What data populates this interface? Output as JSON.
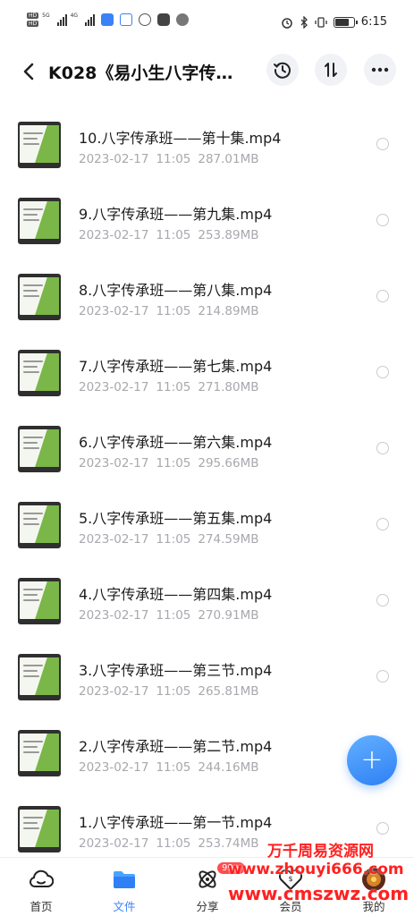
{
  "status_bar": {
    "time": "6:15",
    "network_tags": [
      "HD",
      "HD"
    ],
    "signal_tags": [
      "5G",
      "4G"
    ]
  },
  "header": {
    "title": "K028《易小生八字传…",
    "history_icon": "history-icon",
    "sort_icon": "sort-icon",
    "more_icon": "more-icon"
  },
  "files": [
    {
      "name": "10.八字传承班——第十集.mp4",
      "date": "2023-02-17",
      "time": "11:05",
      "size": "287.01MB"
    },
    {
      "name": "9.八字传承班——第九集.mp4",
      "date": "2023-02-17",
      "time": "11:05",
      "size": "253.89MB"
    },
    {
      "name": "8.八字传承班——第八集.mp4",
      "date": "2023-02-17",
      "time": "11:05",
      "size": "214.89MB"
    },
    {
      "name": "7.八字传承班——第七集.mp4",
      "date": "2023-02-17",
      "time": "11:05",
      "size": "271.80MB"
    },
    {
      "name": "6.八字传承班——第六集.mp4",
      "date": "2023-02-17",
      "time": "11:05",
      "size": "295.66MB"
    },
    {
      "name": "5.八字传承班——第五集.mp4",
      "date": "2023-02-17",
      "time": "11:05",
      "size": "274.59MB"
    },
    {
      "name": "4.八字传承班——第四集.mp4",
      "date": "2023-02-17",
      "time": "11:05",
      "size": "270.91MB"
    },
    {
      "name": "3.八字传承班——第三节.mp4",
      "date": "2023-02-17",
      "time": "11:05",
      "size": "265.81MB"
    },
    {
      "name": "2.八字传承班——第二节.mp4",
      "date": "2023-02-17",
      "time": "11:05",
      "size": "244.16MB"
    },
    {
      "name": "1.八字传承班——第一节.mp4",
      "date": "2023-02-17",
      "time": "11:05",
      "size": "253.74MB"
    }
  ],
  "fab": {
    "label": "+"
  },
  "bottom_nav": {
    "items": [
      {
        "label": "首页",
        "icon": "cloud-home-icon"
      },
      {
        "label": "文件",
        "icon": "folder-icon"
      },
      {
        "label": "分享",
        "icon": "atom-icon"
      },
      {
        "label": "会员",
        "icon": "vip-heart-icon"
      },
      {
        "label": "我的",
        "icon": "avatar-icon"
      }
    ],
    "badge": "99+"
  },
  "watermark": {
    "line1": "万千周易资源网",
    "line2": "www.zhouyi666.com",
    "line3": "www.cmszwz.com"
  },
  "colors": {
    "accent": "#3a82f6",
    "fab_gradient": [
      "#62b0ff",
      "#2f80f5"
    ],
    "meta_text": "#a8a8ae",
    "watermark": "#ff2020",
    "badge": "#ff4d4f"
  }
}
